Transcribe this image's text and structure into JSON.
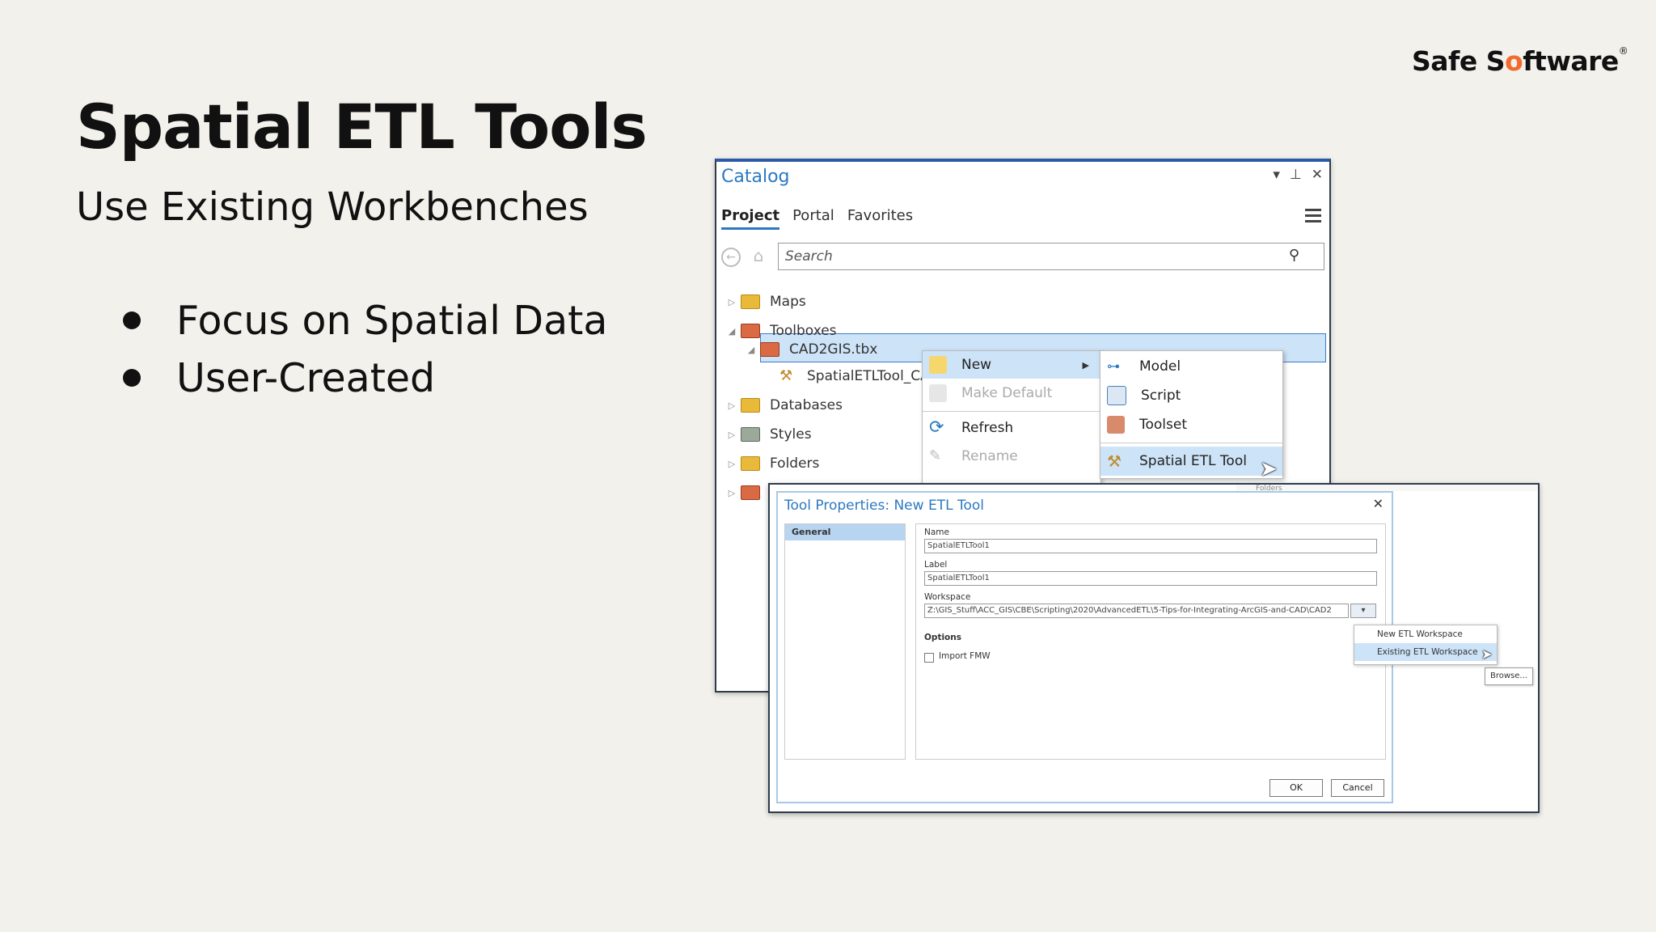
{
  "brand": {
    "logo_text_a": "Safe S",
    "logo_dot": "o",
    "logo_text_b": "ftware",
    "logo_mark": "®"
  },
  "slide": {
    "title": "Spatial ETL Tools",
    "subtitle": "Use Existing Workbenches",
    "bullets": [
      "Focus on Spatial Data",
      "User-Created"
    ]
  },
  "catalog": {
    "title": "Catalog",
    "tabs": [
      "Project",
      "Portal",
      "Favorites"
    ],
    "active_tab": "Project",
    "search_placeholder": "Search",
    "tree": [
      {
        "label": "Maps",
        "expanded": false
      },
      {
        "label": "Toolboxes",
        "expanded": true
      },
      {
        "label": "CAD2GIS.tbx",
        "expanded": true,
        "selected": true
      },
      {
        "label": "SpatialETLTool_CA"
      },
      {
        "label": "Databases",
        "expanded": false
      },
      {
        "label": "Styles",
        "expanded": false
      },
      {
        "label": "Folders",
        "expanded": false
      }
    ]
  },
  "context_menu": {
    "items": [
      {
        "label": "New",
        "highlighted": true,
        "submenu": true
      },
      {
        "label": "Make Default",
        "disabled": true
      },
      {
        "label": "Refresh"
      },
      {
        "label": "Rename",
        "disabled": true
      }
    ]
  },
  "submenu": {
    "items": [
      {
        "label": "Model"
      },
      {
        "label": "Script"
      },
      {
        "label": "Toolset"
      },
      {
        "label": "Spatial ETL Tool",
        "highlighted": true
      }
    ]
  },
  "dialog": {
    "background_text": "Folders",
    "title": "Tool Properties: New ETL Tool",
    "nav_item": "General",
    "name_label": "Name",
    "name_value": "SpatialETLTool1",
    "label_label": "Label",
    "label_value": "SpatialETLTool1",
    "workspace_label": "Workspace",
    "workspace_value": "Z:\\GIS_Stuff\\ACC_GIS\\CBE\\Scripting\\2020\\AdvancedETL\\5-Tips-for-Integrating-ArcGIS-and-CAD\\CAD2",
    "options_label": "Options",
    "import_label": "Import FMW",
    "ok_label": "OK",
    "cancel_label": "Cancel",
    "workspace_menu": [
      "New ETL Workspace",
      "Existing ETL Workspace"
    ],
    "tooltip": "Browse..."
  }
}
